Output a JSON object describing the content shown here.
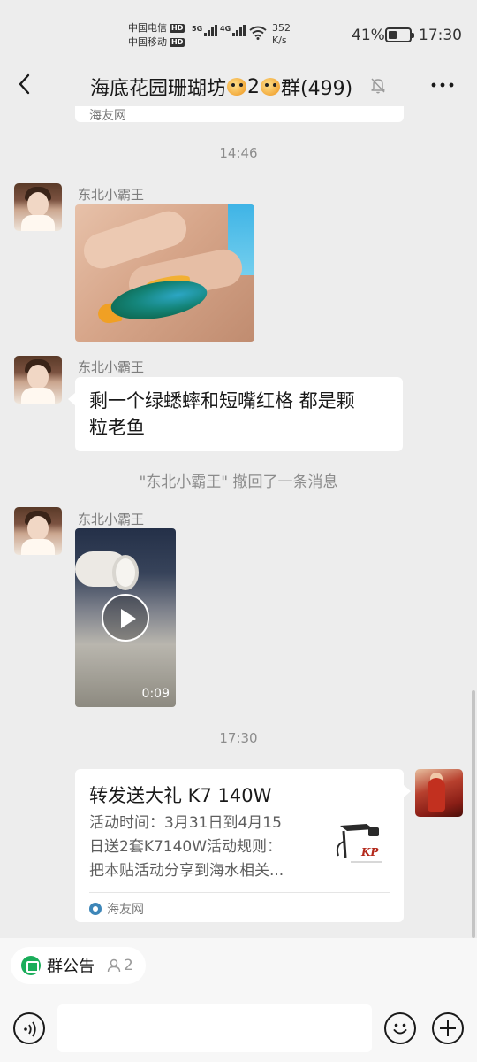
{
  "status_bar": {
    "carrier1": "中国电信",
    "carrier2": "中国移动",
    "hd_badge": "HD",
    "net1": "5G",
    "net2": "4G",
    "speed_value": "352",
    "speed_unit": "K/s",
    "battery_pct": "41%",
    "battery_level": 0.41,
    "time": "17:30"
  },
  "header": {
    "title_part1": "海底花园珊瑚坊",
    "title_part2": "2",
    "title_part3": "群(499)",
    "title_emoji_icon": "pufferfish-icon",
    "back_icon": "chevron-left-icon",
    "mute_icon": "bell-muted-icon",
    "more_icon": "more-horizontal-icon"
  },
  "chat": {
    "partial_card_source": "海友网",
    "timestamp1": "14:46",
    "messages": [
      {
        "sender": "东北小霸王",
        "type": "image"
      },
      {
        "sender": "东北小霸王",
        "type": "text",
        "text_line1": "剩一个绿蟋蟀和短嘴红格 都是颗",
        "text_line2": "粒老鱼"
      },
      {
        "sender": "东北小霸王",
        "type": "video",
        "duration": "0:09"
      }
    ],
    "recall_notice": "\"东北小霸王\" 撤回了一条消息",
    "timestamp2": "17:30",
    "link_card": {
      "title": "转发送大礼 K7 140W",
      "desc_line1": "活动时间：3月31日到4月15",
      "desc_line2": "日送2套K7140W活动规则：",
      "desc_line3": "把本贴活动分享到海水相关...",
      "source": "海友网",
      "thumb_brand": "KP"
    }
  },
  "bottom": {
    "notice_label": "群公告",
    "notice_count": "2",
    "input_placeholder": "",
    "input_value": ""
  },
  "colors": {
    "background": "#ededed",
    "bubble": "#ffffff",
    "accent_green": "#1aad5a"
  }
}
